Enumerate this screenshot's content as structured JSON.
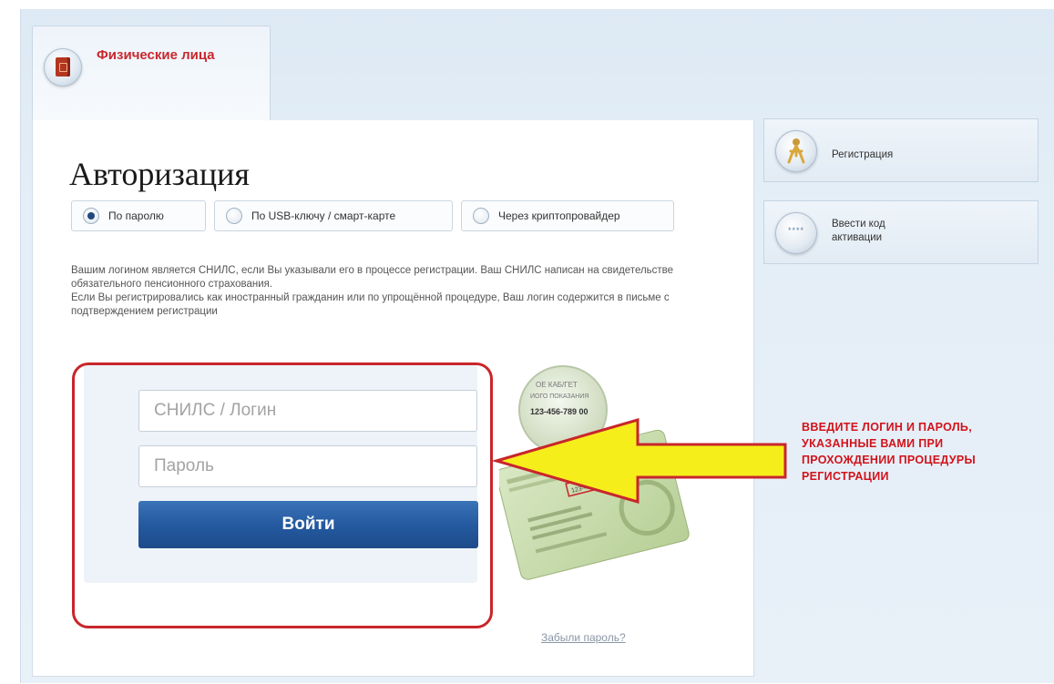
{
  "tab": {
    "label": "Физические лица",
    "icon": "document-icon"
  },
  "page": {
    "title": "Авторизация"
  },
  "auth_methods": [
    {
      "label": "По паролю",
      "selected": true
    },
    {
      "label": "По USB-ключу / смарт-карте",
      "selected": false
    },
    {
      "label": "Через криптопровайдер",
      "selected": false
    }
  ],
  "description": {
    "line1": "Вашим логином является СНИЛС, если Вы указывали его в процессе регистрации. Ваш СНИЛС написан на свидетельстве обязательного пенсионного страхования.",
    "line2": "Если Вы регистрировались как иностранный гражданин или по упрощённой процедуре, Ваш логин содержится в письме с подтверждением регистрации"
  },
  "form": {
    "login_placeholder": "СНИЛС / Логин",
    "password_placeholder": "Пароль",
    "submit_label": "Войти",
    "forgot_label": "Забыли пароль?"
  },
  "snils_card": {
    "number": "123-456-789 00",
    "magnifier_lines": [
      "ОЕ  КАБ/ГЕТ",
      "ИОГО  ПОКАЗАНИЯ"
    ]
  },
  "sidebar": {
    "items": [
      {
        "label": "Регистрация",
        "icon": "person-icon"
      },
      {
        "label": "Ввести код активации",
        "icon": "activation-code-icon",
        "icon_text": "****"
      }
    ]
  },
  "annotation": {
    "text": "ВВЕДИТЕ ЛОГИН И ПАРОЛЬ, УКАЗАННЫЕ ВАМИ ПРИ ПРОХОЖДЕНИИ ПРОЦЕДУРЫ РЕГИСТРАЦИИ",
    "color": "#d3121a"
  },
  "colors": {
    "accent_red": "#c8282d",
    "button_blue": "#255aa0",
    "arrow_yellow": "#f6ee1a"
  }
}
